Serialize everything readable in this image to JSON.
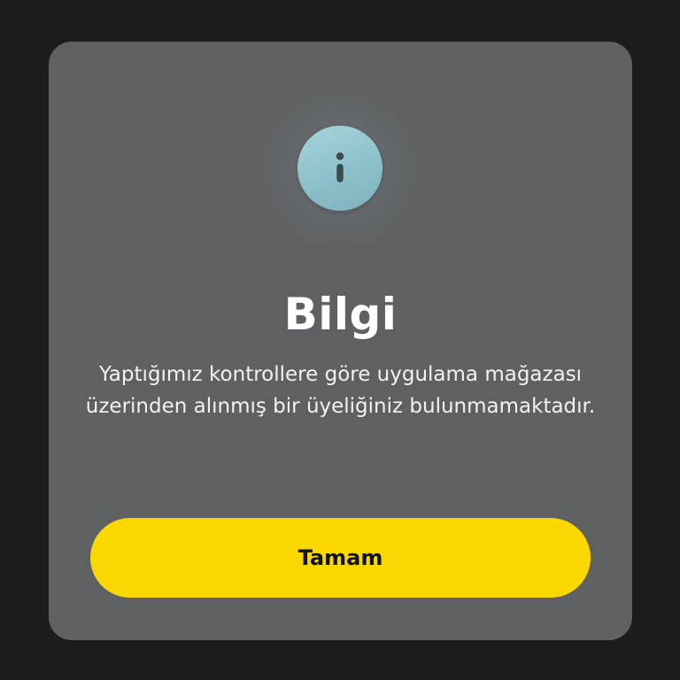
{
  "dialog": {
    "title": "Bilgi",
    "message": "Yaptığımız kontrollere göre uygulama mağazası üzerinden alınmış bir üyeliğiniz bulunmamaktadır.",
    "icon": "info-icon",
    "confirm_label": "Tamam"
  },
  "colors": {
    "background": "#1b1c1e",
    "dialog": "#5f6061",
    "icon_accent": "#8cc0ca",
    "button": "#fbd700",
    "button_text": "#111111"
  }
}
